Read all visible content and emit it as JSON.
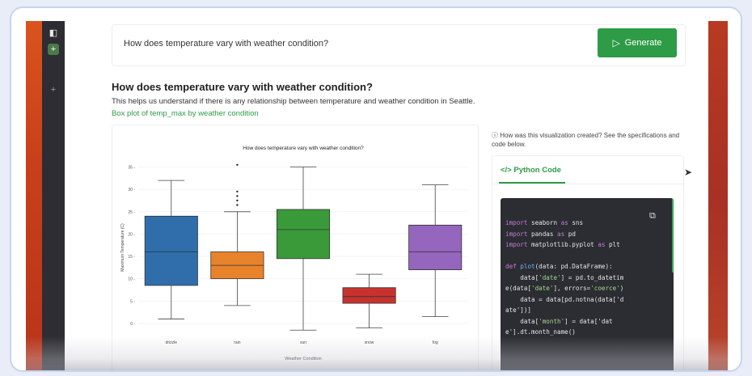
{
  "sidebar": {
    "icons": [
      "panel-icon",
      "new-chat-icon",
      "add-icon"
    ]
  },
  "query": {
    "value": "How does temperature vary with weather condition?",
    "placeholder": "",
    "generate_label": "Generate"
  },
  "visualization": {
    "title": "How does temperature vary with weather condition?",
    "description": "This helps us understand if there is any relationship between temperature and weather condition in Seattle.",
    "chart_link": "Box plot of temp_max by weather condition"
  },
  "info": {
    "text": "How was this visualization created? See the specifications and code below."
  },
  "code_panel": {
    "tab_label": "</> Python Code",
    "lines": [
      "import seaborn as sns",
      "import pandas as pd",
      "import matplotlib.pyplot as plt",
      "",
      "def plot(data: pd.DataFrame):",
      "    data['date'] = pd.to_datetim",
      "e(data['date'], errors='coerce')",
      "    data = data[pd.notna(data['d",
      "ate'])]",
      "    data['month'] = data['dat",
      "e'].dt.month_name()"
    ]
  },
  "chart_data": {
    "type": "box",
    "title": "How does temperature vary with weather condition?",
    "xlabel": "Weather Condition",
    "ylabel": "Maximum Temperature (C)",
    "ylim": [
      -2,
      36
    ],
    "yticks": [
      0,
      5,
      10,
      15,
      20,
      25,
      30,
      35
    ],
    "categories": [
      "drizzle",
      "rain",
      "sun",
      "snow",
      "fog"
    ],
    "colors": [
      "#2f6eaa",
      "#e8832b",
      "#3a9a3a",
      "#c8322e",
      "#9466bd"
    ],
    "boxes": [
      {
        "name": "drizzle",
        "whisker_low": 1,
        "q1": 8.5,
        "median": 16,
        "q3": 24,
        "whisker_high": 32,
        "outliers": []
      },
      {
        "name": "rain",
        "whisker_low": 4,
        "q1": 10,
        "median": 13,
        "q3": 16,
        "whisker_high": 25,
        "outliers": [
          26.5,
          27.5,
          28.5,
          29.5,
          35.5
        ]
      },
      {
        "name": "sun",
        "whisker_low": -1.5,
        "q1": 14.5,
        "median": 21,
        "q3": 25.5,
        "whisker_high": 35,
        "outliers": []
      },
      {
        "name": "snow",
        "whisker_low": -1,
        "q1": 4.5,
        "median": 6,
        "q3": 8,
        "whisker_high": 11,
        "outliers": []
      },
      {
        "name": "fog",
        "whisker_low": 1.5,
        "q1": 12,
        "median": 16,
        "q3": 22,
        "whisker_high": 31,
        "outliers": []
      }
    ]
  }
}
